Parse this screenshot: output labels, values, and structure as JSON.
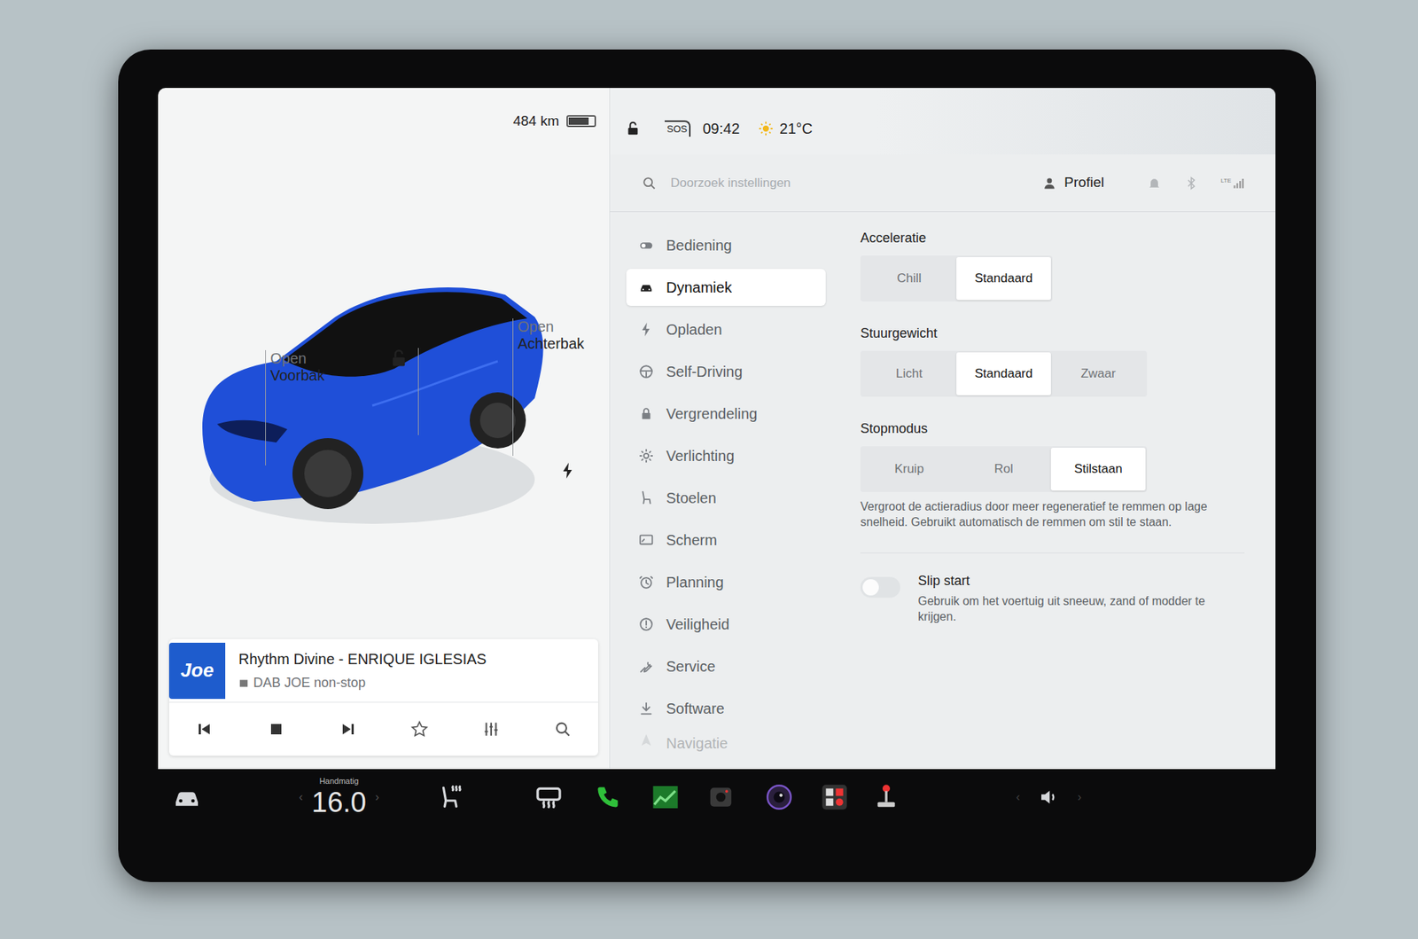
{
  "status_bar": {
    "range": "484 km",
    "battery_level": 0.8,
    "locked": false,
    "sos": "SOS",
    "time": "09:42",
    "temperature": "21°C",
    "network": "LTE"
  },
  "car": {
    "front_trunk": {
      "action": "Open",
      "label": "Voorbak"
    },
    "rear_trunk": {
      "action": "Open",
      "label": "Achterbak"
    },
    "locked": false,
    "charging": true
  },
  "media": {
    "logo": "Joe",
    "title": "Rhythm Divine - ENRIQUE IGLESIAS",
    "source": "DAB JOE non-stop",
    "playing": true,
    "favorite": false
  },
  "search": {
    "placeholder": "Doorzoek instellingen"
  },
  "profile": {
    "label": "Profiel"
  },
  "menu": [
    {
      "label": "Bediening",
      "selected": false
    },
    {
      "label": "Dynamiek",
      "selected": true
    },
    {
      "label": "Opladen",
      "selected": false
    },
    {
      "label": "Self-Driving",
      "selected": false
    },
    {
      "label": "Vergrendeling",
      "selected": false
    },
    {
      "label": "Verlichting",
      "selected": false
    },
    {
      "label": "Stoelen",
      "selected": false
    },
    {
      "label": "Scherm",
      "selected": false
    },
    {
      "label": "Planning",
      "selected": false
    },
    {
      "label": "Veiligheid",
      "selected": false
    },
    {
      "label": "Service",
      "selected": false
    },
    {
      "label": "Software",
      "selected": false
    },
    {
      "label": "Navigatie",
      "selected": false
    }
  ],
  "settings": {
    "groups": [
      {
        "title": "Acceleratie",
        "options": [
          {
            "label": "Chill",
            "selected": false
          },
          {
            "label": "Standaard",
            "selected": true
          }
        ]
      },
      {
        "title": "Stuurgewicht",
        "options": [
          {
            "label": "Licht",
            "selected": false
          },
          {
            "label": "Standaard",
            "selected": true
          },
          {
            "label": "Zwaar",
            "selected": false
          }
        ]
      },
      {
        "title": "Stopmodus",
        "options": [
          {
            "label": "Kruip",
            "selected": false
          },
          {
            "label": "Rol",
            "selected": false
          },
          {
            "label": "Stilstaan",
            "selected": true
          }
        ],
        "description": "Vergroot de actieradius door meer regeneratief te remmen op lage snelheid. Gebruikt automatisch de remmen om stil te staan."
      }
    ],
    "slip_start": {
      "title": "Slip start",
      "description": "Gebruik om het voertuig uit sneeuw, zand of modder te krijgen.",
      "on": false
    }
  },
  "taskbar": {
    "temperature_mode": "Handmatig",
    "temperature": "16.0"
  }
}
